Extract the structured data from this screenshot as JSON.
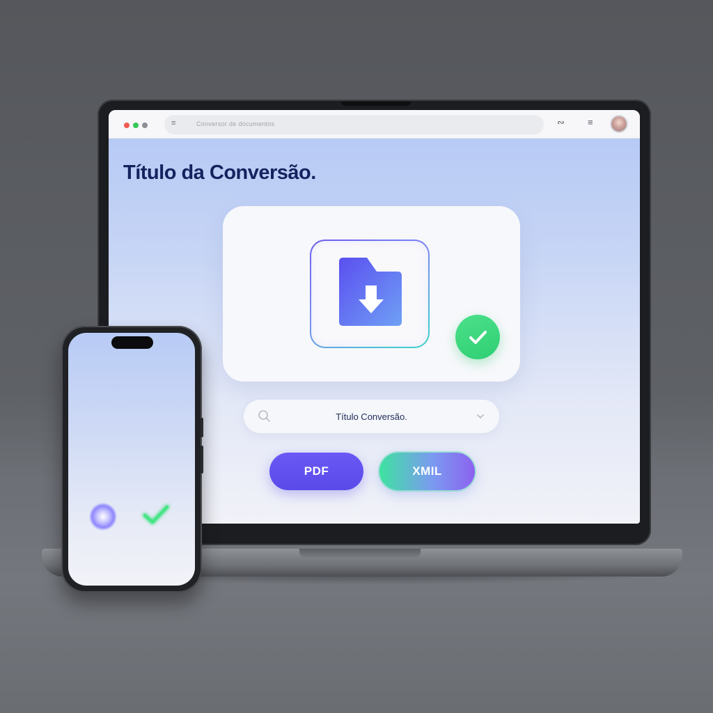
{
  "browser": {
    "url_text": "Conversor de documentos",
    "icons": [
      "menu-icon",
      "share-icon",
      "tabs-icon",
      "profile-avatar"
    ]
  },
  "page": {
    "title": "Título da Conversão."
  },
  "upload_card": {
    "file_icon": "folder-download-icon",
    "status_icon": "check-icon"
  },
  "search": {
    "value": "Título Conversão.",
    "icons": [
      "search-icon",
      "chevron-down-icon"
    ]
  },
  "formats": {
    "pdf_label": "PDF",
    "xml_label": "XMIL"
  },
  "phone": {
    "icons": [
      "glow-dot",
      "check-icon"
    ]
  },
  "colors": {
    "title": "#14225e",
    "pdf_button": "#5f4fef",
    "success": "#34d67a",
    "accent_gradient_start": "#3fe2a0",
    "accent_gradient_end": "#8c62f0"
  }
}
